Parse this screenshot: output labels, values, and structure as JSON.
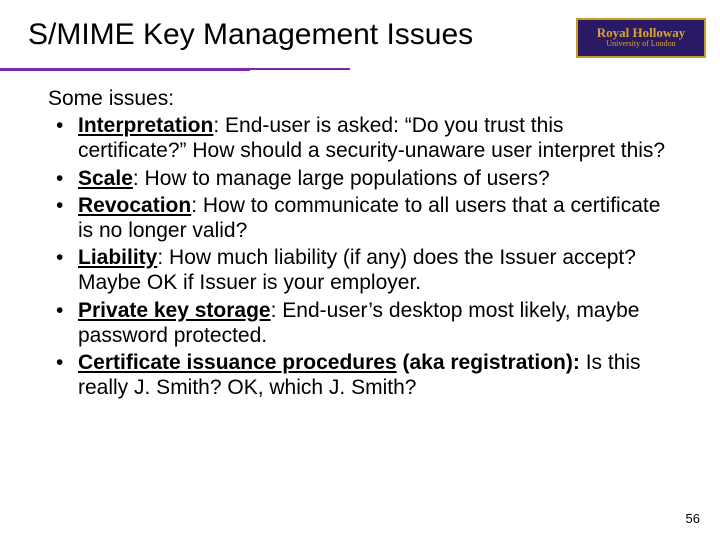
{
  "header": {
    "title": "S/MIME Key Management Issues",
    "logo_line1": "Royal Holloway",
    "logo_line2": "University of London"
  },
  "body": {
    "intro": "Some issues:",
    "bullets": [
      {
        "term": "Interpretation",
        "text": ": End-user is asked: “Do you trust this certificate?” How should a security-unaware user interpret this?"
      },
      {
        "term": "Scale",
        "text": ": How to manage large populations of users?"
      },
      {
        "term": "Revocation",
        "text": ": How to communicate to all users that a certificate is no longer valid?"
      },
      {
        "term": "Liability",
        "text": ": How much liability (if any) does the Issuer accept? Maybe OK if Issuer is your employer."
      },
      {
        "term": "Private key storage",
        "text": ": End-user’s desktop most likely, maybe password protected."
      },
      {
        "term": "Certificate issuance procedures",
        "term_plain": " (aka registration): ",
        "text": "Is this really J. Smith? OK, which J. Smith?"
      }
    ]
  },
  "footer": {
    "page_number": "56"
  }
}
